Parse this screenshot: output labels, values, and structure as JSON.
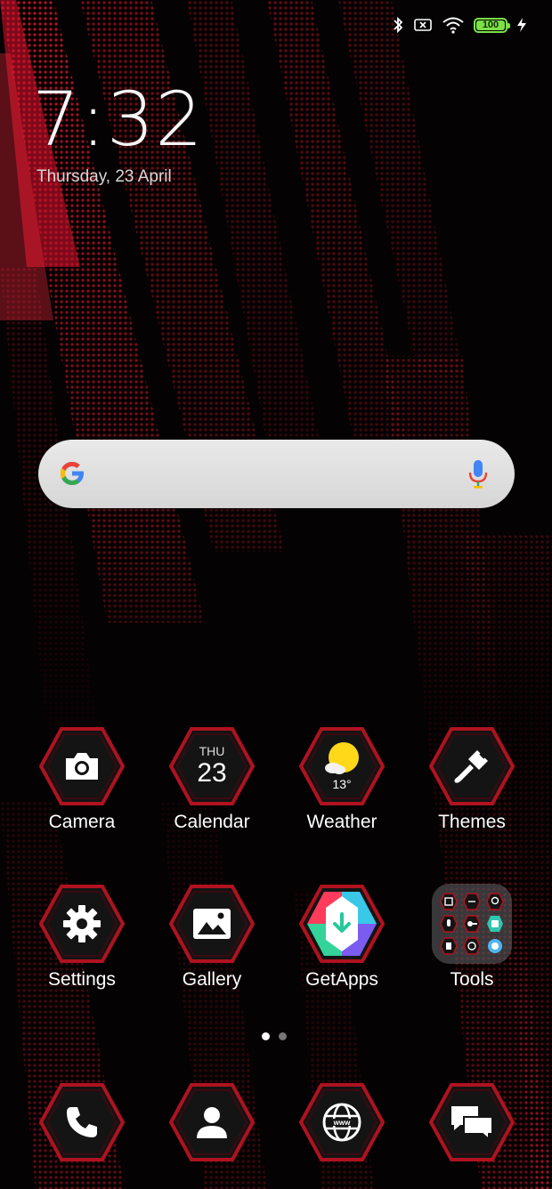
{
  "status_bar": {
    "icons": [
      "bluetooth-icon",
      "no-sim-icon",
      "wifi-icon",
      "battery-icon",
      "charging-icon"
    ],
    "battery_level": "100",
    "battery_color": "#7de047"
  },
  "clock": {
    "time": "7:32",
    "date": "Thursday, 23 April"
  },
  "search": {
    "provider_icon": "google-g-icon",
    "voice_icon": "mic-icon"
  },
  "apps": [
    {
      "label": "Camera",
      "icon": "camera-icon"
    },
    {
      "label": "Calendar",
      "icon": "calendar-icon",
      "day_name": "THU",
      "day_num": "23"
    },
    {
      "label": "Weather",
      "icon": "weather-sun-cloud-icon",
      "temp": "13°"
    },
    {
      "label": "Themes",
      "icon": "paintbrush-icon"
    },
    {
      "label": "Settings",
      "icon": "gear-icon"
    },
    {
      "label": "Gallery",
      "icon": "gallery-image-icon"
    },
    {
      "label": "GetApps",
      "icon": "getapps-download-icon"
    }
  ],
  "folder": {
    "label": "Tools",
    "mini_icons": [
      "scanner-icon",
      "compass-icon",
      "bulb-icon",
      "recorder-icon",
      "toggle-icon",
      "app-icon",
      "notes-icon",
      "clock-icon",
      "cleaner-icon"
    ]
  },
  "pager": {
    "pages": 2,
    "current": 1
  },
  "dock": [
    {
      "name": "phone",
      "icon": "phone-icon"
    },
    {
      "name": "contacts",
      "icon": "contact-person-icon"
    },
    {
      "name": "browser",
      "icon": "browser-globe-icon"
    },
    {
      "name": "messages",
      "icon": "messages-chat-icon"
    }
  ],
  "colors": {
    "accent_red": "#d3142a",
    "hex_frame": "#b0121f",
    "hex_fill": "#151515"
  }
}
